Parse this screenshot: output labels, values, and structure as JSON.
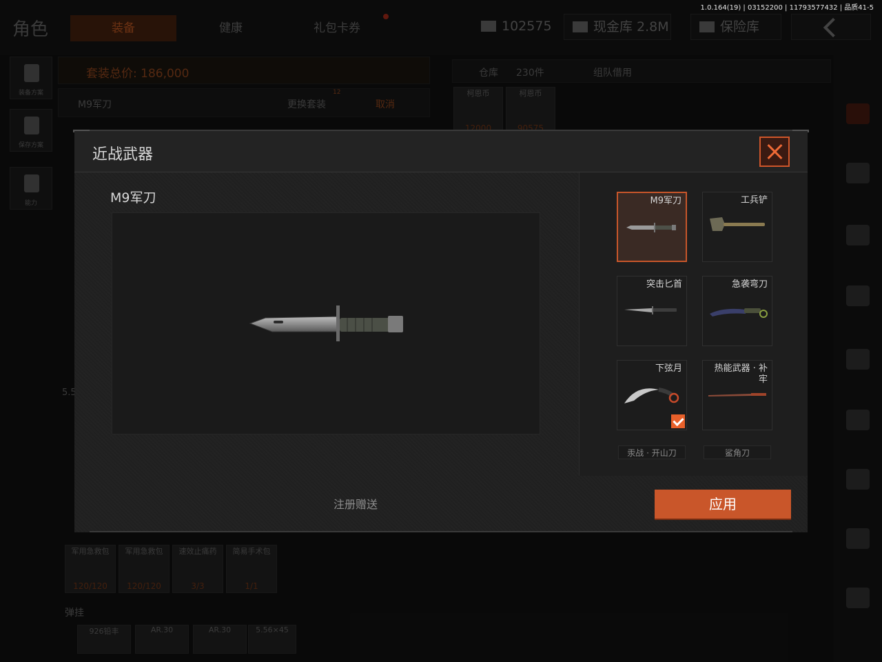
{
  "version": "1.0.164(19) | 03152200 | 11793577432 | 品质41-5",
  "background": {
    "title": "角色",
    "tabs": [
      "装备",
      "健康",
      "礼包卡券"
    ],
    "active_tab_index": 0,
    "resources": {
      "currency": "102575",
      "cash_vault": "现金库 2.8M",
      "safe_box": "保险库"
    },
    "left_rail": [
      "装备方案",
      "保存方案",
      "能力"
    ],
    "loadout_value": "套装总价: 186,000",
    "loadout_name": "M9军刀",
    "change_outfit": "更换套装",
    "change_outfit_badge": "12",
    "cancel": "取消",
    "warehouse": "仓库",
    "warehouse_count": "230件",
    "team_borrow": "组队借用",
    "stash_items": [
      {
        "label": "柯恩币",
        "count": "12000"
      },
      {
        "label": "柯恩币",
        "count": "90575"
      }
    ],
    "medical_items": [
      {
        "label": "军用急救包",
        "count": "120/120"
      },
      {
        "label": "军用急救包",
        "count": "120/120"
      },
      {
        "label": "速效止痛药",
        "count": "3/3"
      },
      {
        "label": "简易手术包",
        "count": "1/1"
      }
    ],
    "ammo_section": "弹挂",
    "ammo_items": [
      "926铅丰",
      "AR.30",
      "AR.30",
      "5.56×45"
    ],
    "side_caliber": "5.5"
  },
  "modal": {
    "title": "近战武器",
    "selected_weapon_name": "M9军刀",
    "source": "注册赠送",
    "apply_label": "应用",
    "slots": [
      {
        "name": "M9军刀",
        "selected": true,
        "equipped": false,
        "icon": "bayonet-icon"
      },
      {
        "name": "工兵铲",
        "selected": false,
        "equipped": false,
        "icon": "shovel-icon"
      },
      {
        "name": "突击匕首",
        "selected": false,
        "equipped": false,
        "icon": "dagger-icon"
      },
      {
        "name": "急袭弯刀",
        "selected": false,
        "equipped": false,
        "icon": "curved-knife-icon"
      },
      {
        "name": "下弦月",
        "selected": false,
        "equipped": true,
        "icon": "karambit-icon"
      },
      {
        "name": "热能武器 · 补牢",
        "selected": false,
        "equipped": false,
        "icon": "katana-icon"
      }
    ],
    "partial_slots": [
      "汞战 · 开山刀",
      "鲨角刀"
    ]
  },
  "colors": {
    "accent": "#c9562a",
    "close_border": "#d0562a",
    "check_bg": "#e8602a"
  }
}
